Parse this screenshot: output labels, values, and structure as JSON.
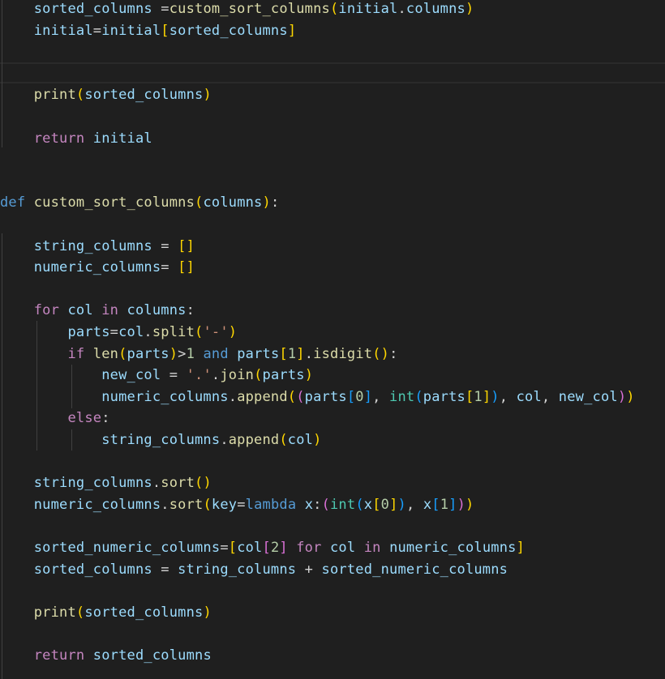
{
  "editor": {
    "language": "python",
    "colors": {
      "background": "#1f1f1f",
      "keyword_control": "#c586c0",
      "keyword": "#569cd6",
      "function": "#dcdcaa",
      "variable": "#9cdcfe",
      "builtin_type": "#4ec9b0",
      "string": "#ce9178",
      "number": "#b5cea8",
      "operator": "#d4d4d4",
      "bracket_level_1": "#ffd700",
      "bracket_level_2": "#da70d6",
      "bracket_level_3": "#179fff"
    },
    "lines": [
      [
        [
          "var",
          "    sorted_columns "
        ],
        [
          "op",
          "="
        ],
        [
          "fn",
          "custom_sort_columns"
        ],
        [
          "b1",
          "("
        ],
        [
          "var",
          "initial"
        ],
        [
          "op",
          "."
        ],
        [
          "var",
          "columns"
        ],
        [
          "b1",
          ")"
        ]
      ],
      [
        [
          "var",
          "    initial"
        ],
        [
          "op",
          "="
        ],
        [
          "var",
          "initial"
        ],
        [
          "b1",
          "["
        ],
        [
          "var",
          "sorted_columns"
        ],
        [
          "b1",
          "]"
        ]
      ],
      [],
      [],
      [
        [
          "fn",
          "    print"
        ],
        [
          "b1",
          "("
        ],
        [
          "var",
          "sorted_columns"
        ],
        [
          "b1",
          ")"
        ]
      ],
      [],
      [
        [
          "kw-ctl",
          "    return"
        ],
        [
          "op",
          " "
        ],
        [
          "var",
          "initial"
        ]
      ],
      [],
      [],
      [
        [
          "kw",
          "def"
        ],
        [
          "op",
          " "
        ],
        [
          "fn",
          "custom_sort_columns"
        ],
        [
          "b1",
          "("
        ],
        [
          "var",
          "columns"
        ],
        [
          "b1",
          ")"
        ],
        [
          "op",
          ":"
        ]
      ],
      [],
      [
        [
          "var",
          "    string_columns "
        ],
        [
          "op",
          "= "
        ],
        [
          "b1",
          "[]"
        ]
      ],
      [
        [
          "var",
          "    numeric_columns"
        ],
        [
          "op",
          "= "
        ],
        [
          "b1",
          "[]"
        ]
      ],
      [],
      [
        [
          "kw-ctl",
          "    for"
        ],
        [
          "op",
          " "
        ],
        [
          "var",
          "col"
        ],
        [
          "op",
          " "
        ],
        [
          "kw-ctl",
          "in"
        ],
        [
          "op",
          " "
        ],
        [
          "var",
          "columns"
        ],
        [
          "op",
          ":"
        ]
      ],
      [
        [
          "var",
          "        parts"
        ],
        [
          "op",
          "="
        ],
        [
          "var",
          "col"
        ],
        [
          "op",
          "."
        ],
        [
          "fn",
          "split"
        ],
        [
          "b1",
          "("
        ],
        [
          "str",
          "'-'"
        ],
        [
          "b1",
          ")"
        ]
      ],
      [
        [
          "kw-ctl",
          "        if"
        ],
        [
          "op",
          " "
        ],
        [
          "fn",
          "len"
        ],
        [
          "b1",
          "("
        ],
        [
          "var",
          "parts"
        ],
        [
          "b1",
          ")"
        ],
        [
          "op",
          ">"
        ],
        [
          "num",
          "1"
        ],
        [
          "op",
          " "
        ],
        [
          "kw",
          "and"
        ],
        [
          "op",
          " "
        ],
        [
          "var",
          "parts"
        ],
        [
          "b1",
          "["
        ],
        [
          "num",
          "1"
        ],
        [
          "b1",
          "]"
        ],
        [
          "op",
          "."
        ],
        [
          "fn",
          "isdigit"
        ],
        [
          "b1",
          "()"
        ],
        [
          "op",
          ":"
        ]
      ],
      [
        [
          "var",
          "            new_col "
        ],
        [
          "op",
          "= "
        ],
        [
          "str",
          "'.'"
        ],
        [
          "op",
          "."
        ],
        [
          "fn",
          "join"
        ],
        [
          "b1",
          "("
        ],
        [
          "var",
          "parts"
        ],
        [
          "b1",
          ")"
        ]
      ],
      [
        [
          "var",
          "            numeric_columns"
        ],
        [
          "op",
          "."
        ],
        [
          "fn",
          "append"
        ],
        [
          "b1",
          "("
        ],
        [
          "b2",
          "("
        ],
        [
          "var",
          "parts"
        ],
        [
          "b3",
          "["
        ],
        [
          "num",
          "0"
        ],
        [
          "b3",
          "]"
        ],
        [
          "op",
          ", "
        ],
        [
          "cls",
          "int"
        ],
        [
          "b3",
          "("
        ],
        [
          "var",
          "parts"
        ],
        [
          "b1",
          "["
        ],
        [
          "num",
          "1"
        ],
        [
          "b1",
          "]"
        ],
        [
          "b3",
          ")"
        ],
        [
          "op",
          ", "
        ],
        [
          "var",
          "col"
        ],
        [
          "op",
          ", "
        ],
        [
          "var",
          "new_col"
        ],
        [
          "b2",
          ")"
        ],
        [
          "b1",
          ")"
        ]
      ],
      [
        [
          "kw-ctl",
          "        else"
        ],
        [
          "op",
          ":"
        ]
      ],
      [
        [
          "var",
          "            string_columns"
        ],
        [
          "op",
          "."
        ],
        [
          "fn",
          "append"
        ],
        [
          "b1",
          "("
        ],
        [
          "var",
          "col"
        ],
        [
          "b1",
          ")"
        ]
      ],
      [],
      [
        [
          "var",
          "    string_columns"
        ],
        [
          "op",
          "."
        ],
        [
          "fn",
          "sort"
        ],
        [
          "b1",
          "()"
        ]
      ],
      [
        [
          "var",
          "    numeric_columns"
        ],
        [
          "op",
          "."
        ],
        [
          "fn",
          "sort"
        ],
        [
          "b1",
          "("
        ],
        [
          "var",
          "key"
        ],
        [
          "op",
          "="
        ],
        [
          "kw",
          "lambda"
        ],
        [
          "op",
          " "
        ],
        [
          "var",
          "x"
        ],
        [
          "op",
          ":"
        ],
        [
          "b2",
          "("
        ],
        [
          "cls",
          "int"
        ],
        [
          "b3",
          "("
        ],
        [
          "var",
          "x"
        ],
        [
          "b1",
          "["
        ],
        [
          "num",
          "0"
        ],
        [
          "b1",
          "]"
        ],
        [
          "b3",
          ")"
        ],
        [
          "op",
          ", "
        ],
        [
          "var",
          "x"
        ],
        [
          "b3",
          "["
        ],
        [
          "num",
          "1"
        ],
        [
          "b3",
          "]"
        ],
        [
          "b2",
          ")"
        ],
        [
          "b1",
          ")"
        ]
      ],
      [],
      [
        [
          "var",
          "    sorted_numeric_columns"
        ],
        [
          "op",
          "="
        ],
        [
          "b1",
          "["
        ],
        [
          "var",
          "col"
        ],
        [
          "b2",
          "["
        ],
        [
          "num",
          "2"
        ],
        [
          "b2",
          "]"
        ],
        [
          "op",
          " "
        ],
        [
          "kw-ctl",
          "for"
        ],
        [
          "op",
          " "
        ],
        [
          "var",
          "col"
        ],
        [
          "op",
          " "
        ],
        [
          "kw-ctl",
          "in"
        ],
        [
          "op",
          " "
        ],
        [
          "var",
          "numeric_columns"
        ],
        [
          "b1",
          "]"
        ]
      ],
      [
        [
          "var",
          "    sorted_columns "
        ],
        [
          "op",
          "= "
        ],
        [
          "var",
          "string_columns "
        ],
        [
          "op",
          "+ "
        ],
        [
          "var",
          "sorted_numeric_columns"
        ]
      ],
      [],
      [
        [
          "fn",
          "    print"
        ],
        [
          "b1",
          "("
        ],
        [
          "var",
          "sorted_columns"
        ],
        [
          "b1",
          ")"
        ]
      ],
      [],
      [
        [
          "kw-ctl",
          "    return"
        ],
        [
          "op",
          " "
        ],
        [
          "var",
          "sorted_columns"
        ]
      ]
    ]
  }
}
